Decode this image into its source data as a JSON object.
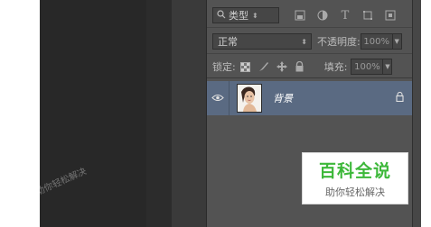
{
  "layers_panel": {
    "filter_kind": "类型",
    "blend_mode": "正常",
    "opacity_label": "不透明度:",
    "opacity_value": "100%",
    "lock_label": "锁定:",
    "fill_label": "填充:",
    "fill_value": "100%",
    "layers": [
      {
        "name": "背景",
        "visible": true,
        "locked": true
      }
    ]
  },
  "watermark": {
    "title": "百科全说",
    "subtitle": "助你轻松解决"
  },
  "diagonal_watermark": "百科全说助你轻松解决"
}
